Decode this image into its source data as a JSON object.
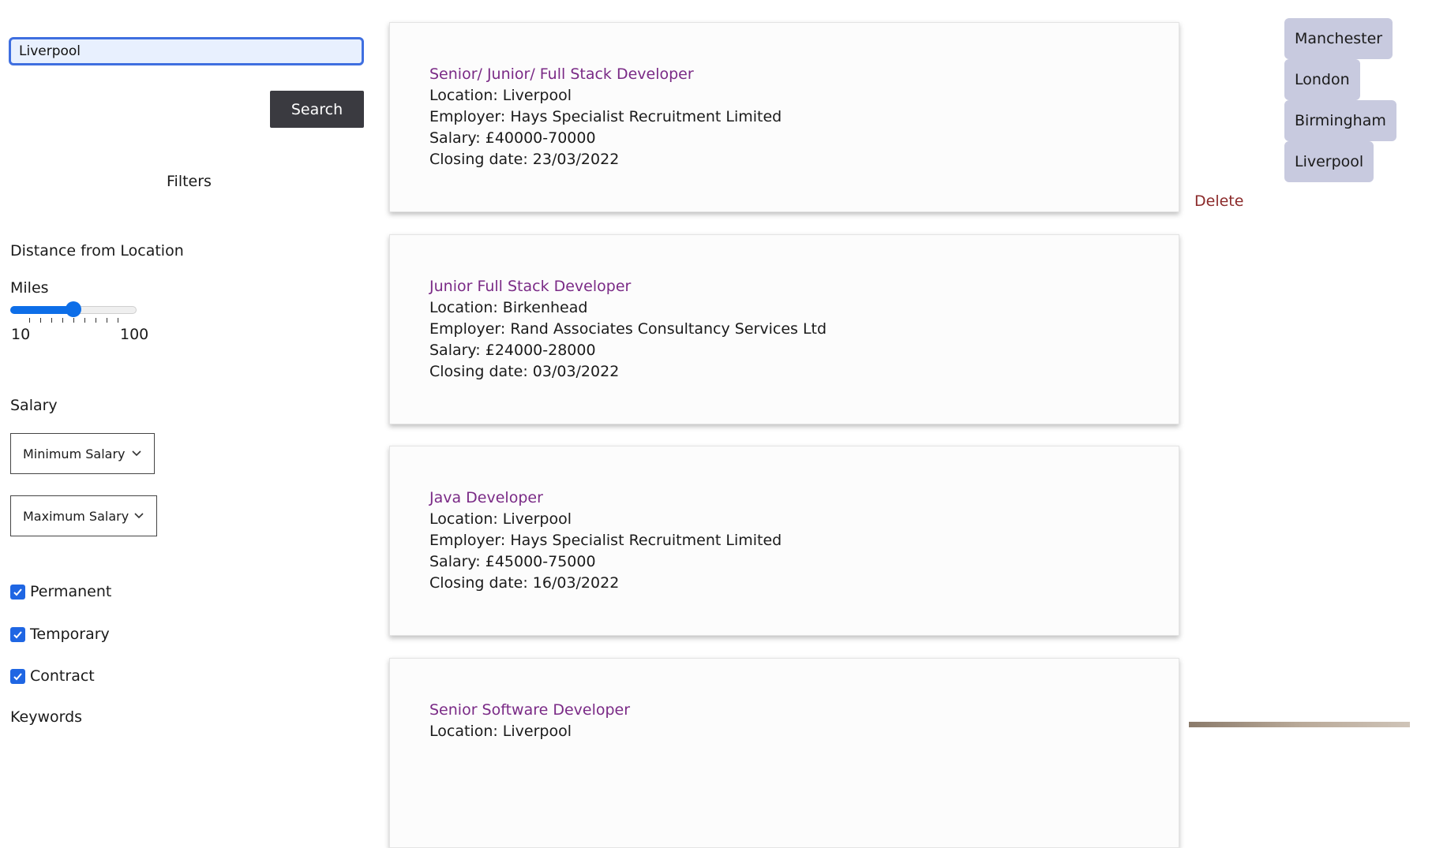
{
  "search": {
    "value": "Liverpool",
    "button_label": "Search"
  },
  "filters": {
    "title": "Filters",
    "distance": {
      "label": "Distance from Location",
      "unit_label": "Miles",
      "min_label": "10",
      "max_label": "100",
      "min": 10,
      "max": 100,
      "value": 55
    },
    "salary": {
      "label": "Salary",
      "min_select": "Minimum Salary",
      "max_select": "Maximum Salary"
    },
    "job_types": [
      {
        "label": "Permanent",
        "checked": true
      },
      {
        "label": "Temporary",
        "checked": true
      },
      {
        "label": "Contract",
        "checked": true
      }
    ],
    "keywords_label": "Keywords"
  },
  "jobs": [
    {
      "title": "Senior/ Junior/ Full Stack Developer",
      "location": "Location: Liverpool",
      "employer": "Employer: Hays Specialist Recruitment Limited",
      "salary": "Salary: £40000-70000",
      "closing": "Closing date: 23/03/2022"
    },
    {
      "title": "Junior Full Stack Developer",
      "location": "Location: Birkenhead",
      "employer": "Employer: Rand Associates Consultancy Services Ltd",
      "salary": "Salary: £24000-28000",
      "closing": "Closing date: 03/03/2022"
    },
    {
      "title": "Java Developer",
      "location": "Location: Liverpool",
      "employer": "Employer: Hays Specialist Recruitment Limited",
      "salary": "Salary: £45000-75000",
      "closing": "Closing date: 16/03/2022"
    },
    {
      "title": "Senior Software Developer",
      "location": "Location: Liverpool",
      "employer": "",
      "salary": "",
      "closing": ""
    }
  ],
  "saved_searches": {
    "items": [
      "Manchester",
      "London",
      "Birmingham",
      "Liverpool"
    ],
    "delete_label": "Delete"
  },
  "colors": {
    "accent": "#0d6ee8",
    "job_title": "#7a2a86",
    "delete": "#8b2a2a",
    "chip": "#c8cadf",
    "button": "#3a3a40"
  }
}
